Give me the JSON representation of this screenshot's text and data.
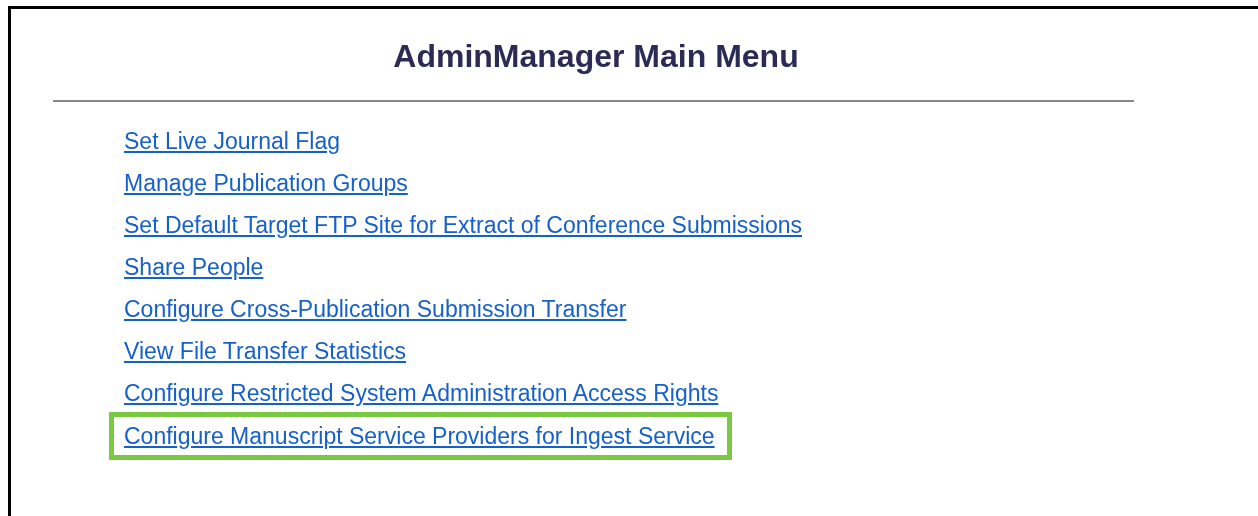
{
  "title": "AdminManager Main Menu",
  "links": [
    {
      "label": "Set Live Journal Flag",
      "highlighted": false
    },
    {
      "label": "Manage Publication Groups",
      "highlighted": false
    },
    {
      "label": "Set Default Target FTP Site for Extract of Conference Submissions",
      "highlighted": false
    },
    {
      "label": "Share People",
      "highlighted": false
    },
    {
      "label": "Configure Cross-Publication Submission Transfer",
      "highlighted": false
    },
    {
      "label": "View File Transfer Statistics",
      "highlighted": false
    },
    {
      "label": "Configure Restricted System Administration Access Rights",
      "highlighted": false
    },
    {
      "label": "Configure Manuscript Service Providers for Ingest Service",
      "highlighted": true
    }
  ]
}
